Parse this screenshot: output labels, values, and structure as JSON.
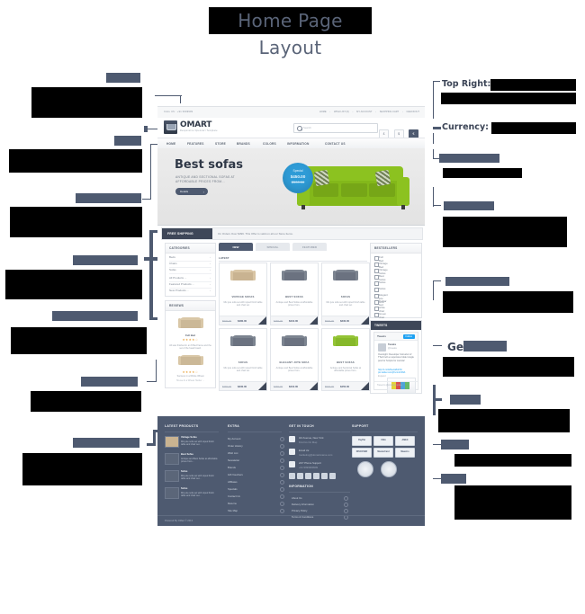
{
  "page": {
    "title": "Home Page Layout"
  },
  "annotations": {
    "right_labels": [
      {
        "name": "top-right",
        "label": "Top Right:",
        "redacted": true
      },
      {
        "name": "currency",
        "label": "Currency:",
        "redacted": true
      },
      {
        "name": "get-in-touch",
        "label": "Get",
        "redacted": true
      }
    ],
    "left": [
      {
        "name": "callout-top-bar",
        "title": "",
        "body": "",
        "redacted": true
      },
      {
        "name": "callout-logo",
        "title": "",
        "body": "",
        "redacted": true
      },
      {
        "name": "callout-main-menu",
        "title": "",
        "body": "",
        "redacted": true
      },
      {
        "name": "callout-slideshow",
        "title": "",
        "body": "",
        "redacted": true
      },
      {
        "name": "callout-categories",
        "title": "",
        "body": "",
        "redacted": true
      },
      {
        "name": "callout-reviews",
        "title": "",
        "body": "",
        "redacted": true
      },
      {
        "name": "callout-footer-products",
        "title": "",
        "body": "",
        "redacted": true
      }
    ],
    "right": [
      {
        "name": "callout-search",
        "title": "",
        "body": "",
        "redacted": true
      },
      {
        "name": "callout-banner",
        "title": "",
        "body": "",
        "redacted": true
      },
      {
        "name": "callout-bestsellers",
        "title": "",
        "body": "",
        "redacted": true
      },
      {
        "name": "callout-tweets",
        "title": "",
        "body": "",
        "redacted": true
      },
      {
        "name": "callout-information",
        "title": "",
        "body": "",
        "redacted": true
      },
      {
        "name": "callout-support",
        "title": "",
        "body": "",
        "redacted": true
      }
    ]
  },
  "mockup": {
    "topbar": {
      "phone": "CALL US : +91 9999999",
      "links": [
        "HOME",
        "WISH LIST (0)",
        "MY ACCOUNT",
        "SHOPPING CART",
        "CHECKOUT"
      ],
      "separator": "›"
    },
    "logo": {
      "name": "OMART",
      "tagline": "Responsive Opencart Template"
    },
    "search": {
      "placeholder": "Search"
    },
    "currency": [
      {
        "symbol": "£",
        "active": false
      },
      {
        "symbol": "$",
        "active": false
      },
      {
        "symbol": "€",
        "active": true
      }
    ],
    "nav": [
      "HOME",
      "FEATURES",
      "STORE",
      "BRANDS",
      "COLORS",
      "INFORMATION",
      "CONTACT US"
    ],
    "banner": {
      "heading": "Best sofas",
      "text": "ANTIQUE AND SECTIONAL SOFAS AT AFFORDABLE PRICES FROM...",
      "button": "Details",
      "arrow": "›",
      "badge": {
        "label": "Special",
        "price": "$450.00",
        "old_price": "$500.00"
      }
    },
    "shipping": {
      "badge": "FREE SHIPPING",
      "text": "On Orders Over $399. This Offer is valid on all our Store Items."
    },
    "categories": {
      "title": "CATEGORIES",
      "items": [
        "Beds",
        "Chairs",
        "Sofas"
      ],
      "links": [
        "All Products ...",
        "Featured Products ...",
        "New Products ..."
      ],
      "caret": "›"
    },
    "reviews": {
      "title": "REVIEWS",
      "product": "Full Bed",
      "stars": "★★★★☆",
      "body": "All was finished in an 8 Bed frame and the set of the head board.",
      "author": "Success in a Whole Wheat",
      "meta": "House At a Wheat Harder ..."
    },
    "tabs": [
      {
        "label": "NEW",
        "active": true
      },
      {
        "label": "SPECIAL",
        "active": false
      },
      {
        "label": "FEATURED",
        "active": false
      }
    ],
    "latest_label": "LATEST",
    "products": [
      {
        "title": "VINTAGE SOFAS",
        "desc": "Mix jute sofa set with roped finish table and chair set",
        "old_price": "$500.00",
        "price": "$480.00",
        "color": "tan"
      },
      {
        "title": "BEST SOFAS",
        "desc": "Antique and Best Sofas at affordable prices from..",
        "old_price": "$450.00",
        "price": "$410.00",
        "color": "gray"
      },
      {
        "title": "SOFAS",
        "desc": "Mix jute sofa set with roped finish table and chair set",
        "old_price": "$500.00",
        "price": "$330.00",
        "color": "gray"
      },
      {
        "title": "SOFAS",
        "desc": "Mix jute sofa set with roped finish table and chair set",
        "old_price": "$350.00",
        "price": "$330.00",
        "color": "gray"
      },
      {
        "title": "ELEGANT JUTE SOFA",
        "desc": "Antique and Best Sofas at affordable prices from..",
        "old_price": "$450.00",
        "price": "$410.00",
        "color": "gray"
      },
      {
        "title": "BEST SOFAS",
        "desc": "Antique and Sectional Sofas at affordable prices from..",
        "old_price": "$500.00",
        "price": "$450.00",
        "color": "green"
      }
    ],
    "bestsellers": {
      "title": "BESTSELLERS",
      "items": [
        "Full Bed",
        "Vintage Bed",
        "Vintage Sofas",
        "Best Sofas",
        "Sofas",
        "Sofas",
        "Elegant jute sofa",
        "Dubiar bed",
        "white chair",
        "Green chair"
      ]
    },
    "tweets": {
      "title": "TWEETS",
      "header": "Tweets",
      "follow": "Follow",
      "account": "Tweaks",
      "handle": "@tweaks",
      "time": "15 Jul",
      "body": "Oversight: Developer Instructor of TTech left a responsive folder single post for Scripts for Joomla!",
      "link": "http://t.co/4ZAeJa8ohHc pic.twitter.com/jKvrmcFZ9A",
      "action": "Expand",
      "compose": "Tweet to @omartemplate"
    },
    "footer": {
      "latest_products": {
        "title": "LATEST PRODUCTS",
        "items": [
          {
            "name": "Vintage Sofas",
            "desc": "Mix jute sofa set with roped finish table and chair set..."
          },
          {
            "name": "Best Sofas",
            "desc": "Antique and Best Sofas at affordable prices from..."
          },
          {
            "name": "Sofas",
            "desc": "Mix jute sofa set with roped finish table and chair set..."
          },
          {
            "name": "Sofas",
            "desc": "Mix jute sofa set with roped finish table and chair set..."
          }
        ]
      },
      "extra": {
        "title": "EXTRA",
        "items": [
          "My Account",
          "Order History",
          "Wish List",
          "Newsletter",
          "Brands",
          "Gift Vouchers",
          "Affiliates",
          "Specials",
          "Contact Us",
          "Returns",
          "Site Map"
        ]
      },
      "get_in_touch": {
        "title": "GET IN TOUCH",
        "address_line1": "3rd Avenue, New York",
        "address_line2": "Find Us On Map",
        "email_line1": "Email Us:",
        "email_line2": "marketing@domainname.com",
        "phone_line1": "24/7 Phone Support",
        "phone_line2": "+91 9999999999",
        "social": [
          "twitter-icon",
          "facebook-icon",
          "google-plus-icon",
          "rss-icon",
          "linkedin-icon",
          "pinterest-icon"
        ]
      },
      "information": {
        "title": "INFORMATION",
        "items": [
          "About Us",
          "Delivery Information",
          "Privacy Policy",
          "Terms & Conditions"
        ]
      },
      "support": {
        "title": "SUPPORT",
        "payments": [
          "PayPal",
          "VISA",
          "AMEX",
          "DISCOVER",
          "MasterCard",
          "Maestro"
        ],
        "seals": [
          "secure-seal",
          "verified-seal"
        ]
      },
      "copyright": "Powered By OMart © 2013"
    }
  }
}
